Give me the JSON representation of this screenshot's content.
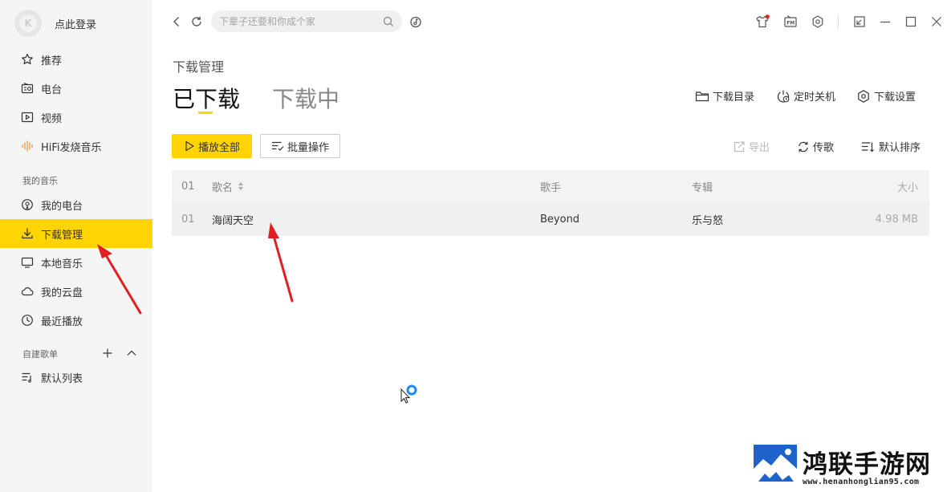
{
  "sidebar": {
    "login_label": "点此登录",
    "nav_main": [
      {
        "label": "推荐"
      },
      {
        "label": "电台"
      },
      {
        "label": "视频"
      },
      {
        "label": "HiFi发烧音乐"
      }
    ],
    "my_music_label": "我的音乐",
    "nav_my": [
      {
        "label": "我的电台"
      },
      {
        "label": "下载管理"
      },
      {
        "label": "本地音乐"
      },
      {
        "label": "我的云盘"
      },
      {
        "label": "最近播放"
      }
    ],
    "playlist_section_label": "自建歌单",
    "playlists": [
      {
        "label": "默认列表"
      }
    ]
  },
  "topbar": {
    "search_placeholder": "下辈子还要和你成个家"
  },
  "main": {
    "page_title": "下载管理",
    "tabs": [
      {
        "label": "已下载",
        "active": true
      },
      {
        "label": "下载中",
        "active": false
      }
    ],
    "top_actions": {
      "download_dir": "下载目录",
      "timer_shutdown": "定时关机",
      "download_settings": "下载设置"
    },
    "play_all": "播放全部",
    "batch_ops": "批量操作",
    "tool_actions": {
      "export": "导出",
      "upload": "传歌",
      "sort": "默认排序"
    },
    "table": {
      "columns": {
        "index": "01",
        "name": "歌名",
        "artist": "歌手",
        "album": "专辑",
        "size": "大小"
      },
      "rows": [
        {
          "index": "01",
          "name": "海阔天空",
          "artist": "Beyond",
          "album": "乐与怒",
          "size": "4.98 MB"
        }
      ]
    }
  },
  "watermark": {
    "title": "鸿联手游网",
    "url": "www.henanhonglian95.com"
  },
  "colors": {
    "accent": "#ffd400",
    "sidebar_bg": "#f5f5f5",
    "arrow": "#e02020",
    "cursor_ring": "#1a8cff"
  }
}
